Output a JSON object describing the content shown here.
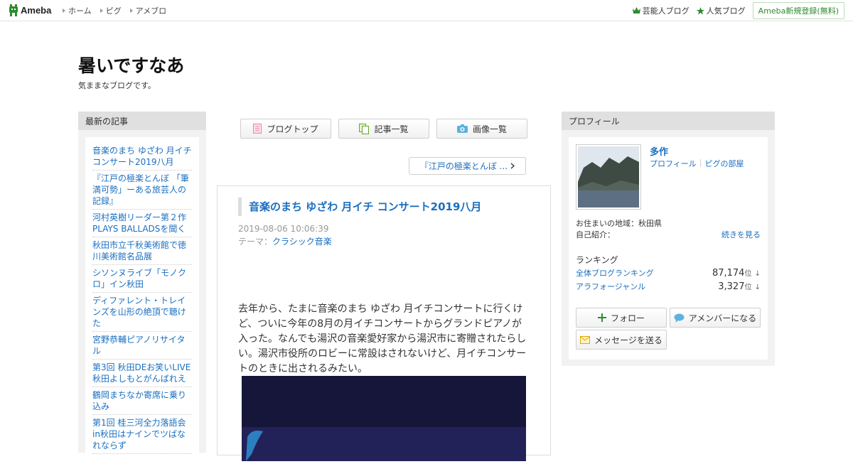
{
  "topbar": {
    "logo_text": "Ameba",
    "nav": [
      {
        "label": "ホーム"
      },
      {
        "label": "ピグ"
      },
      {
        "label": "アメブロ"
      }
    ],
    "right_links": [
      {
        "label": "芸能人ブログ",
        "icon": "crown-icon"
      },
      {
        "label": "人気ブログ",
        "icon": "star-icon"
      }
    ],
    "register_label": "Ameba新規登録(無料)"
  },
  "blog": {
    "title": "暑いですなあ",
    "description": "気ままなブログです。"
  },
  "left_sidebar": {
    "heading": "最新の記事",
    "entries": [
      {
        "text": "音楽のまち ゆざわ 月イチコンサート2019八月"
      },
      {
        "text": "『江戸の極楽とんぼ 「筆満可勢」ーある旅芸人の記録』"
      },
      {
        "text": "河村英樹リーダー第２作 PLAYS BALLADSを聞く"
      },
      {
        "text": "秋田市立千秋美術館で徳川美術館名品展"
      },
      {
        "text": "シソンヌライブ「モノクロ」イン秋田"
      },
      {
        "text": "ディファレント・トレインズを山形の絶頂で聴けた"
      },
      {
        "text": "宮野恭輔ピアノリサイタル"
      },
      {
        "text": "第3回 秋田DEお笑いLIVE 秋田よしもとがんばれえ"
      },
      {
        "text": "鶴岡まちなか寄席に乗り込み"
      },
      {
        "text": "第1回 桂三河全力落語会in秋田はナインでツばなれならず"
      }
    ]
  },
  "tabs": [
    {
      "label": "ブログトップ",
      "icon": "document-icon"
    },
    {
      "label": "記事一覧",
      "icon": "copy-icon"
    },
    {
      "label": "画像一覧",
      "icon": "camera-icon"
    }
  ],
  "prev_link": "『江戸の極楽とんぼ ...",
  "article": {
    "title": "音楽のまち ゆざわ 月イチ コンサート2019八月",
    "date": "2019-08-06 10:06:39",
    "theme_label": "テーマ：",
    "theme_value": "クラシック音楽",
    "body": "去年から、たまに音楽のまち ゆざわ 月イチコンサートに行くけど、ついに今年の8月の月イチコンサートからグランドピアノが入った。なんでも湯沢の音楽愛好家から湯沢市に寄贈されたらしい。湯沢市役所のロビーに常設はされないけど、月イチコンサートのときに出されるみたい。"
  },
  "profile": {
    "heading": "プロフィール",
    "name": "多作",
    "link_profile": "プロフィール",
    "link_pigg": "ピグの部屋",
    "region": "お住まいの地域：秋田県",
    "intro_label": "自己紹介：",
    "more_label": "続きを見る",
    "ranking_heading": "ランキング",
    "rankings": [
      {
        "name": "全体ブログランキング",
        "value": "87,174",
        "unit": "位",
        "arrow": "↓"
      },
      {
        "name": "アラフォージャンル",
        "value": "3,327",
        "unit": "位",
        "arrow": "↓"
      }
    ],
    "buttons": {
      "follow": "フォロー",
      "member": "アメンバーになる",
      "message": "メッセージを送る"
    }
  },
  "colors": {
    "link": "#1a6fc0",
    "accent_green": "#2e8b2e",
    "sidebar_bg": "#f2f2f2"
  }
}
